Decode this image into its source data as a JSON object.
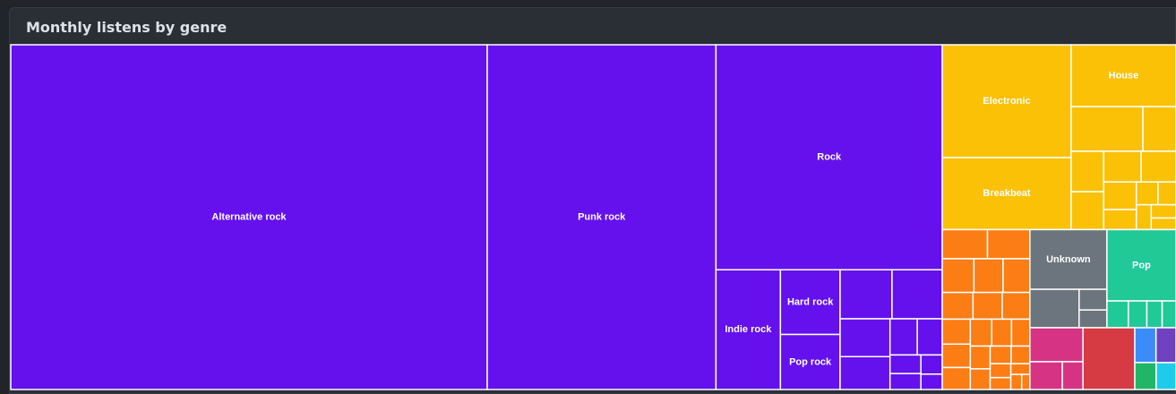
{
  "panel": {
    "title": "Monthly listens by genre"
  },
  "chart_data": {
    "type": "treemap",
    "title": "Monthly listens by genre",
    "unit": "listens",
    "groups": [
      {
        "name": "Rock",
        "color": "#6411ed",
        "items": [
          {
            "name": "Alternative rock",
            "value": 200000,
            "label": "Alternative rock"
          },
          {
            "name": "Punk rock",
            "value": 96000,
            "label": "Punk rock"
          },
          {
            "name": "Rock",
            "value": 62000,
            "label": "Rock"
          },
          {
            "name": "Indie rock",
            "value": 9400,
            "label": "Indie rock"
          },
          {
            "name": "Hard rock",
            "value": 4700,
            "label": "Hard rock"
          },
          {
            "name": "Pop rock",
            "value": 4000,
            "label": "Pop rock"
          },
          {
            "name": "",
            "value": 3000
          },
          {
            "name": "",
            "value": 3100
          },
          {
            "name": "",
            "value": 2300
          },
          {
            "name": "",
            "value": 2000
          },
          {
            "name": "",
            "value": 1200
          },
          {
            "name": "",
            "value": 1100
          },
          {
            "name": "",
            "value": 700
          },
          {
            "name": "",
            "value": 600
          },
          {
            "name": "",
            "value": 500
          },
          {
            "name": "",
            "value": 400
          }
        ]
      },
      {
        "name": "Electronic",
        "color": "#fac107",
        "items": [
          {
            "name": "Electronic",
            "value": 17700,
            "label": "Electronic"
          },
          {
            "name": "Breakbeat",
            "value": 11300,
            "label": "Breakbeat"
          },
          {
            "name": "House",
            "value": 7900,
            "label": "House"
          },
          {
            "name": "",
            "value": 3900
          },
          {
            "name": "",
            "value": 1800
          },
          {
            "name": "",
            "value": 1600
          },
          {
            "name": "",
            "value": 1500
          },
          {
            "name": "",
            "value": 1400
          },
          {
            "name": "",
            "value": 1300
          },
          {
            "name": "",
            "value": 1100
          },
          {
            "name": "",
            "value": 800
          },
          {
            "name": "",
            "value": 600
          },
          {
            "name": "",
            "value": 500
          },
          {
            "name": "",
            "value": 450
          },
          {
            "name": "",
            "value": 400
          },
          {
            "name": "",
            "value": 350
          }
        ]
      },
      {
        "name": "",
        "color": "#fc7d14",
        "items": [
          {
            "name": "",
            "value": 1600
          },
          {
            "name": "",
            "value": 1500
          },
          {
            "name": "",
            "value": 1300
          },
          {
            "name": "",
            "value": 1200
          },
          {
            "name": "",
            "value": 1100
          },
          {
            "name": "",
            "value": 1000
          },
          {
            "name": "",
            "value": 950
          },
          {
            "name": "",
            "value": 900
          },
          {
            "name": "",
            "value": 850
          },
          {
            "name": "",
            "value": 800
          },
          {
            "name": "",
            "value": 750
          },
          {
            "name": "",
            "value": 700
          },
          {
            "name": "",
            "value": 650
          },
          {
            "name": "",
            "value": 600
          },
          {
            "name": "",
            "value": 550
          },
          {
            "name": "",
            "value": 500
          },
          {
            "name": "",
            "value": 450
          },
          {
            "name": "",
            "value": 400
          },
          {
            "name": "",
            "value": 350
          },
          {
            "name": "",
            "value": 300
          },
          {
            "name": "",
            "value": 250
          },
          {
            "name": "",
            "value": 200
          },
          {
            "name": "",
            "value": 150
          }
        ]
      },
      {
        "name": "Unknown",
        "color": "#6c747d",
        "items": [
          {
            "name": "Unknown",
            "value": 5600,
            "label": "Unknown"
          },
          {
            "name": "",
            "value": 2300
          },
          {
            "name": "",
            "value": 700
          },
          {
            "name": "",
            "value": 600
          }
        ]
      },
      {
        "name": "",
        "color": "#d63a42",
        "items": [
          {
            "name": "",
            "value": 3900
          }
        ]
      },
      {
        "name": "Pop",
        "color": "#20c996",
        "items": [
          {
            "name": "Pop",
            "value": 6000,
            "label": "Pop"
          },
          {
            "name": "",
            "value": 700
          },
          {
            "name": "",
            "value": 600
          },
          {
            "name": "",
            "value": 500
          },
          {
            "name": "",
            "value": 450
          }
        ]
      },
      {
        "name": "",
        "color": "#d63384",
        "items": [
          {
            "name": "",
            "value": 2200
          },
          {
            "name": "",
            "value": 1100
          },
          {
            "name": "",
            "value": 700
          }
        ]
      },
      {
        "name": "",
        "color": "#3b8cf8",
        "items": [
          {
            "name": "",
            "value": 900
          }
        ]
      },
      {
        "name": "",
        "color": "#6f42c1",
        "items": [
          {
            "name": "",
            "value": 850
          }
        ]
      },
      {
        "name": "",
        "color": "#21b567",
        "items": [
          {
            "name": "",
            "value": 700
          }
        ]
      },
      {
        "name": "",
        "color": "#1fcbeb",
        "items": [
          {
            "name": "",
            "value": 650
          }
        ]
      }
    ]
  }
}
